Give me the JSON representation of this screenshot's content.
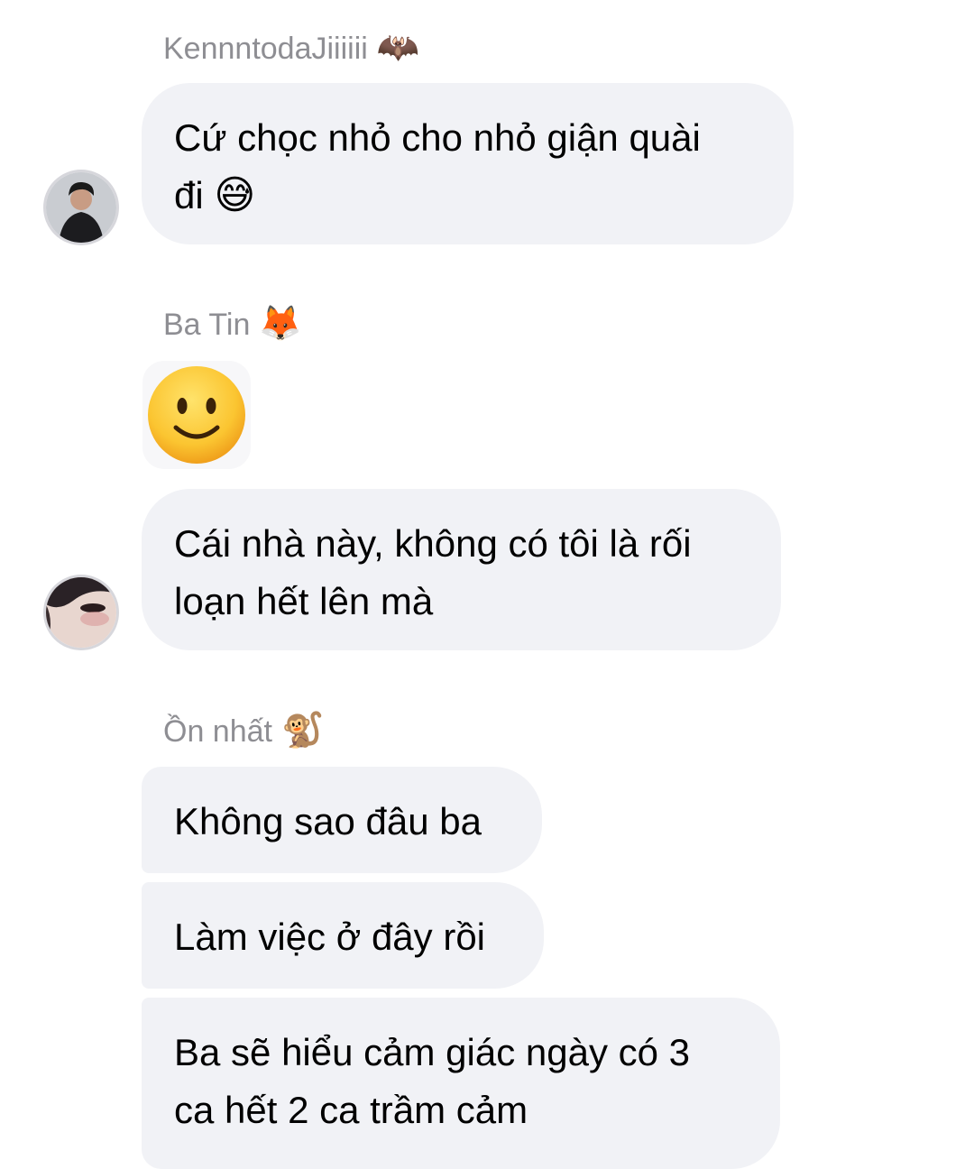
{
  "groups": [
    {
      "sender": "KennntodaJiiiiii",
      "sender_emoji": "🦇",
      "messages": [
        {
          "line1": "Cứ chọc nhỏ cho nhỏ giận quài",
          "line2": "đi",
          "emoji": "😅"
        }
      ]
    },
    {
      "sender": "Ba Tin",
      "sender_emoji": "🦊",
      "sticker": "slightly-smiling-face",
      "messages": [
        {
          "line1": "Cái nhà này, không có tôi là rối",
          "line2": "loạn hết lên mà"
        }
      ]
    },
    {
      "sender": "Ồn nhất",
      "sender_emoji": "🐒",
      "messages": [
        {
          "line1": "Không sao đâu ba"
        },
        {
          "line1": "Làm việc ở đây rồi"
        },
        {
          "line1": "Ba sẽ hiểu cảm giác ngày có 3",
          "line2": "ca hết 2 ca trầm cảm"
        }
      ]
    }
  ],
  "colors": {
    "bubble_bg": "#f1f2f6",
    "sender_text": "#8e8e93",
    "message_text": "#000000"
  }
}
